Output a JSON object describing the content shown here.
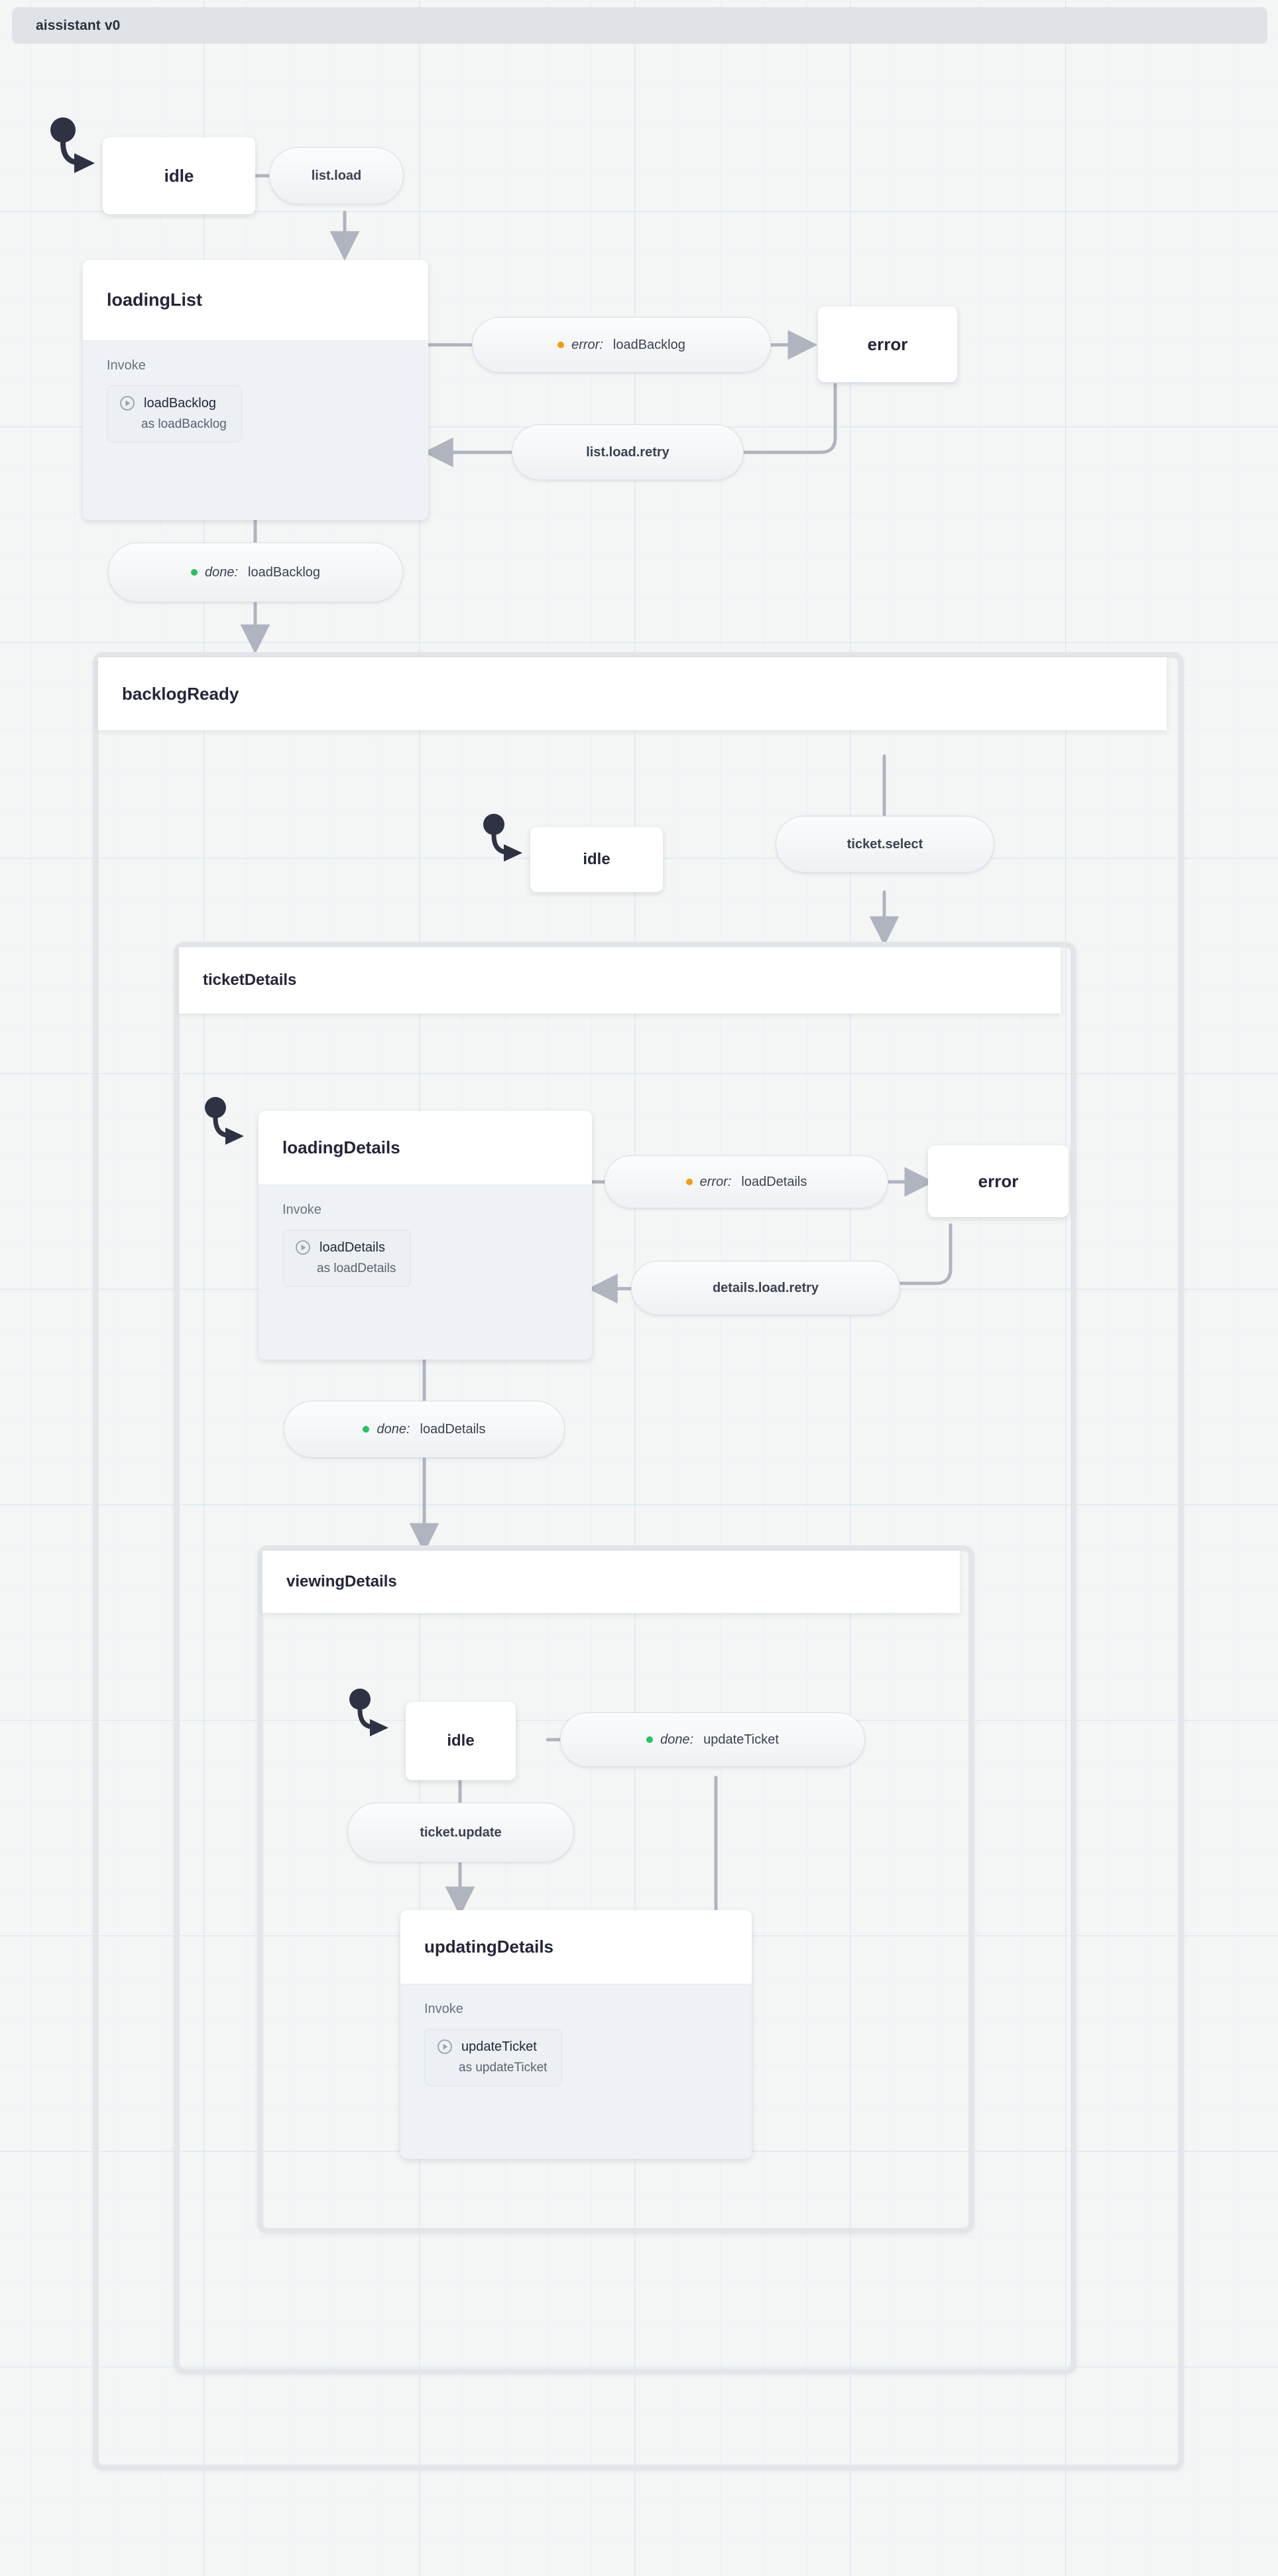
{
  "machine": {
    "title": "aissistant v0"
  },
  "colors": {
    "background": "#f4f6f5",
    "grid_line": "#dce9f7",
    "titlebar": "#dfe3e8",
    "state_fill": "#ffffff",
    "state_body_fill": "#eef2f6",
    "container_border": "#e2e6ea",
    "edge": "#b0b4bf",
    "text": "#23263a",
    "muted_text": "#6b7280",
    "done_dot": "#22c55e",
    "error_dot": "#f59e0b"
  },
  "labels": {
    "invoke": "Invoke",
    "as_prefix": "as "
  },
  "states": {
    "idle_root": {
      "name": "idle"
    },
    "loadingList": {
      "name": "loadingList",
      "invoke_src": "loadBacklog",
      "invoke_id": "as loadBacklog"
    },
    "error_root": {
      "name": "error"
    },
    "backlogReady": {
      "name": "backlogReady"
    },
    "idle_backlog": {
      "name": "idle"
    },
    "ticketDetails": {
      "name": "ticketDetails"
    },
    "loadingDetails": {
      "name": "loadingDetails",
      "invoke_src": "loadDetails",
      "invoke_id": "as loadDetails"
    },
    "error_details": {
      "name": "error"
    },
    "viewingDetails": {
      "name": "viewingDetails"
    },
    "idle_viewing": {
      "name": "idle"
    },
    "updatingDetails": {
      "name": "updatingDetails",
      "invoke_src": "updateTicket",
      "invoke_id": "as updateTicket"
    }
  },
  "transitions": {
    "list_load": {
      "event": "list.load"
    },
    "error_loadBacklog": {
      "kind": "error",
      "keyword": "error:",
      "target": "loadBacklog"
    },
    "list_load_retry": {
      "event": "list.load.retry"
    },
    "done_loadBacklog": {
      "kind": "done",
      "keyword": "done:",
      "target": "loadBacklog"
    },
    "ticket_select": {
      "event": "ticket.select"
    },
    "error_loadDetails": {
      "kind": "error",
      "keyword": "error:",
      "target": "loadDetails"
    },
    "details_load_retry": {
      "event": "details.load.retry"
    },
    "done_loadDetails": {
      "kind": "done",
      "keyword": "done:",
      "target": "loadDetails"
    },
    "done_updateTicket": {
      "kind": "done",
      "keyword": "done:",
      "target": "updateTicket"
    },
    "ticket_update": {
      "event": "ticket.update"
    }
  }
}
